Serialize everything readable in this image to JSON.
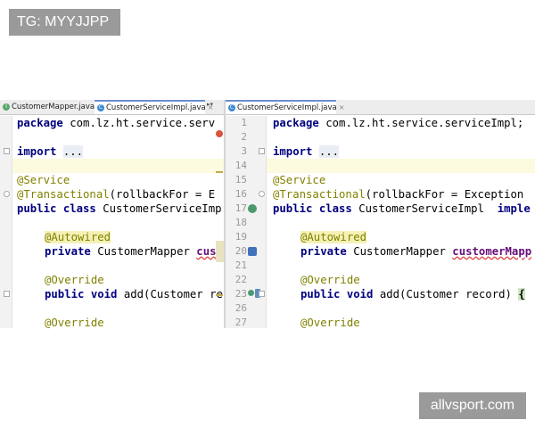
{
  "top_badge": "TG: MYYJJPP",
  "watermark": "allvsport.com",
  "ide": {
    "left_tabs": [
      {
        "label": "CustomerMapper.java",
        "icon": "interface-icon",
        "active": false
      },
      {
        "label": "CustomerServiceImpl.java",
        "icon": "class-icon",
        "active": true
      }
    ],
    "right_tabs": [
      {
        "label": "CustomerServiceImpl.java",
        "icon": "class-icon",
        "active": true
      }
    ],
    "tab_close_glyph": "×",
    "tab_split_glyph": "▸▾",
    "left_pane": {
      "lines": {
        "l1_kw": "package",
        "l1_rest": " com.lz.ht.service.serv",
        "l3_kw": "import",
        "l3_fold": "...",
        "l5": "@Service",
        "l6_ann": "@Transactional",
        "l6_rest": "(rollbackFor = E",
        "l7_kw": "public class",
        "l7_rest": " CustomerServiceImp",
        "l9": "@Autowired",
        "l10_kw": "private",
        "l10_type": " CustomerMapper ",
        "l10_field": "cus",
        "l12": "@Override",
        "l13_kw": "public void",
        "l13_rest": " add(Customer re",
        "l15": "@Override"
      }
    },
    "right_pane": {
      "line_numbers": [
        "1",
        "2",
        "3",
        "14",
        "15",
        "16",
        "17",
        "18",
        "19",
        "20",
        "21",
        "22",
        "23",
        "26",
        "27"
      ],
      "lines": {
        "l1_kw": "package",
        "l1_rest": " com.lz.ht.service.serviceImpl;",
        "l3_kw": "import",
        "l3_fold": "...",
        "l5": "@Service",
        "l6_ann": "@Transactional",
        "l6_rest": "(rollbackFor = Exception",
        "l7_kw": "public class",
        "l7_rest": " CustomerServiceImpl  ",
        "l7_kw2": "imple",
        "l9": "@Autowired",
        "l10_kw": "private",
        "l10_type": " CustomerMapper ",
        "l10_field": "customerMapp",
        "l12": "@Override",
        "l13_kw": "public void",
        "l13_rest": " add(Customer record) ",
        "l13_brace": "{",
        "l15": "@Override"
      }
    }
  }
}
